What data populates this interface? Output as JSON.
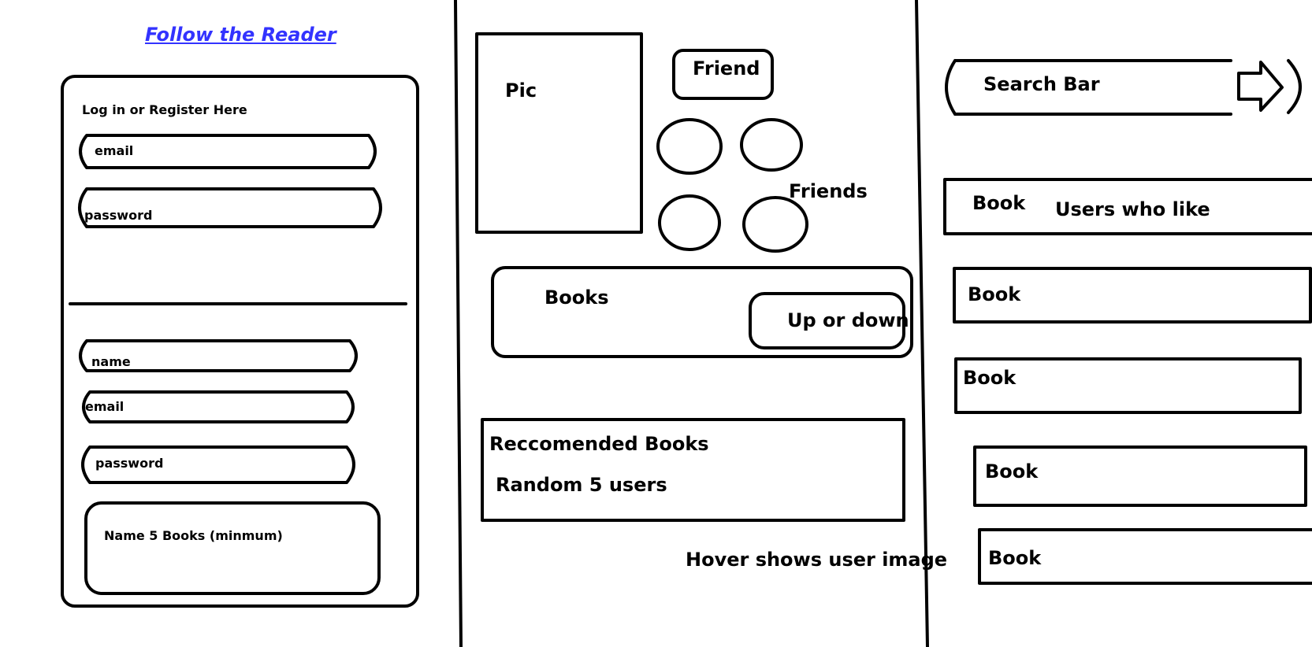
{
  "colors": {
    "ink": "#000000",
    "link": "#3333ff",
    "background": "#ffffff"
  },
  "left_panel": {
    "title": "Follow the Reader",
    "login_heading": "Log in or Register Here",
    "login_email_placeholder": "email",
    "login_password_placeholder": "password",
    "register_name_placeholder": "name",
    "register_email_placeholder": "email",
    "register_password_placeholder": "password",
    "books_placeholder": "Name 5 Books (minmum)"
  },
  "middle_panel": {
    "pic_label": "Pic",
    "friend_button": "Friend",
    "friends_label": "Friends",
    "books_label": "Books",
    "vote_button": "Up or down",
    "recommended_title": "Reccomended Books",
    "random_users": "Random 5 users",
    "hover_note": "Hover shows user image"
  },
  "right_panel": {
    "search_placeholder": "Search Bar",
    "search_icon": "arrow-right-icon",
    "book_rows": [
      {
        "label": "Book",
        "note": "Users who like"
      },
      {
        "label": "Book"
      },
      {
        "label": "Book"
      },
      {
        "label": "Book"
      },
      {
        "label": "Book"
      }
    ]
  }
}
